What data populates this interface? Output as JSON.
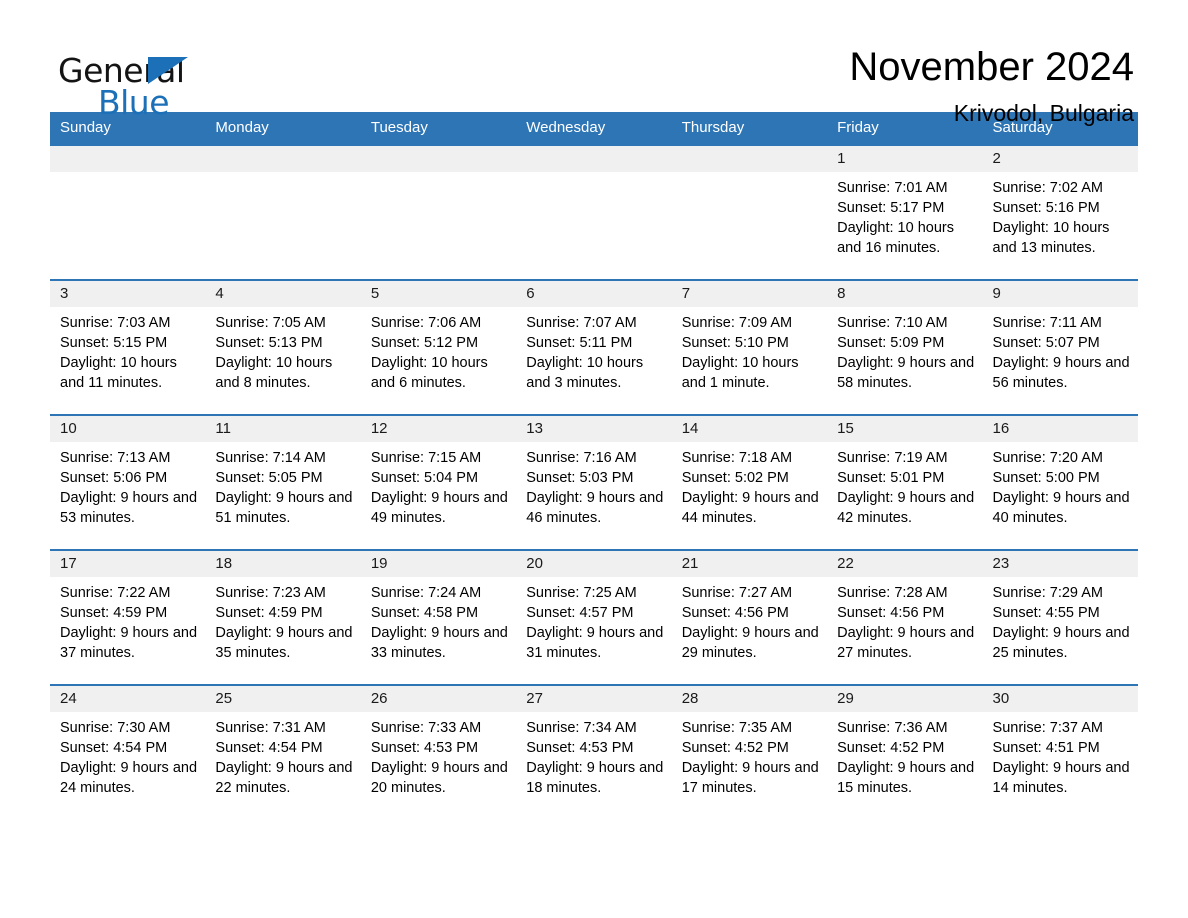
{
  "logo": {
    "word_one": "General",
    "word_two": "Blue",
    "triangle_color": "#1c70b8"
  },
  "header": {
    "month_title": "November 2024",
    "location": "Krivodol, Bulgaria"
  },
  "theme": {
    "header_blue": "#2e75b6",
    "daynum_strip": "#f0f0f0",
    "text": "#000000"
  },
  "calendar": {
    "weekday_headers": [
      "Sunday",
      "Monday",
      "Tuesday",
      "Wednesday",
      "Thursday",
      "Friday",
      "Saturday"
    ],
    "weeks": [
      [
        {
          "day": "",
          "sunrise": "",
          "sunset": "",
          "daylight": ""
        },
        {
          "day": "",
          "sunrise": "",
          "sunset": "",
          "daylight": ""
        },
        {
          "day": "",
          "sunrise": "",
          "sunset": "",
          "daylight": ""
        },
        {
          "day": "",
          "sunrise": "",
          "sunset": "",
          "daylight": ""
        },
        {
          "day": "",
          "sunrise": "",
          "sunset": "",
          "daylight": ""
        },
        {
          "day": "1",
          "sunrise": "Sunrise: 7:01 AM",
          "sunset": "Sunset: 5:17 PM",
          "daylight": "Daylight: 10 hours and 16 minutes."
        },
        {
          "day": "2",
          "sunrise": "Sunrise: 7:02 AM",
          "sunset": "Sunset: 5:16 PM",
          "daylight": "Daylight: 10 hours and 13 minutes."
        }
      ],
      [
        {
          "day": "3",
          "sunrise": "Sunrise: 7:03 AM",
          "sunset": "Sunset: 5:15 PM",
          "daylight": "Daylight: 10 hours and 11 minutes."
        },
        {
          "day": "4",
          "sunrise": "Sunrise: 7:05 AM",
          "sunset": "Sunset: 5:13 PM",
          "daylight": "Daylight: 10 hours and 8 minutes."
        },
        {
          "day": "5",
          "sunrise": "Sunrise: 7:06 AM",
          "sunset": "Sunset: 5:12 PM",
          "daylight": "Daylight: 10 hours and 6 minutes."
        },
        {
          "day": "6",
          "sunrise": "Sunrise: 7:07 AM",
          "sunset": "Sunset: 5:11 PM",
          "daylight": "Daylight: 10 hours and 3 minutes."
        },
        {
          "day": "7",
          "sunrise": "Sunrise: 7:09 AM",
          "sunset": "Sunset: 5:10 PM",
          "daylight": "Daylight: 10 hours and 1 minute."
        },
        {
          "day": "8",
          "sunrise": "Sunrise: 7:10 AM",
          "sunset": "Sunset: 5:09 PM",
          "daylight": "Daylight: 9 hours and 58 minutes."
        },
        {
          "day": "9",
          "sunrise": "Sunrise: 7:11 AM",
          "sunset": "Sunset: 5:07 PM",
          "daylight": "Daylight: 9 hours and 56 minutes."
        }
      ],
      [
        {
          "day": "10",
          "sunrise": "Sunrise: 7:13 AM",
          "sunset": "Sunset: 5:06 PM",
          "daylight": "Daylight: 9 hours and 53 minutes."
        },
        {
          "day": "11",
          "sunrise": "Sunrise: 7:14 AM",
          "sunset": "Sunset: 5:05 PM",
          "daylight": "Daylight: 9 hours and 51 minutes."
        },
        {
          "day": "12",
          "sunrise": "Sunrise: 7:15 AM",
          "sunset": "Sunset: 5:04 PM",
          "daylight": "Daylight: 9 hours and 49 minutes."
        },
        {
          "day": "13",
          "sunrise": "Sunrise: 7:16 AM",
          "sunset": "Sunset: 5:03 PM",
          "daylight": "Daylight: 9 hours and 46 minutes."
        },
        {
          "day": "14",
          "sunrise": "Sunrise: 7:18 AM",
          "sunset": "Sunset: 5:02 PM",
          "daylight": "Daylight: 9 hours and 44 minutes."
        },
        {
          "day": "15",
          "sunrise": "Sunrise: 7:19 AM",
          "sunset": "Sunset: 5:01 PM",
          "daylight": "Daylight: 9 hours and 42 minutes."
        },
        {
          "day": "16",
          "sunrise": "Sunrise: 7:20 AM",
          "sunset": "Sunset: 5:00 PM",
          "daylight": "Daylight: 9 hours and 40 minutes."
        }
      ],
      [
        {
          "day": "17",
          "sunrise": "Sunrise: 7:22 AM",
          "sunset": "Sunset: 4:59 PM",
          "daylight": "Daylight: 9 hours and 37 minutes."
        },
        {
          "day": "18",
          "sunrise": "Sunrise: 7:23 AM",
          "sunset": "Sunset: 4:59 PM",
          "daylight": "Daylight: 9 hours and 35 minutes."
        },
        {
          "day": "19",
          "sunrise": "Sunrise: 7:24 AM",
          "sunset": "Sunset: 4:58 PM",
          "daylight": "Daylight: 9 hours and 33 minutes."
        },
        {
          "day": "20",
          "sunrise": "Sunrise: 7:25 AM",
          "sunset": "Sunset: 4:57 PM",
          "daylight": "Daylight: 9 hours and 31 minutes."
        },
        {
          "day": "21",
          "sunrise": "Sunrise: 7:27 AM",
          "sunset": "Sunset: 4:56 PM",
          "daylight": "Daylight: 9 hours and 29 minutes."
        },
        {
          "day": "22",
          "sunrise": "Sunrise: 7:28 AM",
          "sunset": "Sunset: 4:56 PM",
          "daylight": "Daylight: 9 hours and 27 minutes."
        },
        {
          "day": "23",
          "sunrise": "Sunrise: 7:29 AM",
          "sunset": "Sunset: 4:55 PM",
          "daylight": "Daylight: 9 hours and 25 minutes."
        }
      ],
      [
        {
          "day": "24",
          "sunrise": "Sunrise: 7:30 AM",
          "sunset": "Sunset: 4:54 PM",
          "daylight": "Daylight: 9 hours and 24 minutes."
        },
        {
          "day": "25",
          "sunrise": "Sunrise: 7:31 AM",
          "sunset": "Sunset: 4:54 PM",
          "daylight": "Daylight: 9 hours and 22 minutes."
        },
        {
          "day": "26",
          "sunrise": "Sunrise: 7:33 AM",
          "sunset": "Sunset: 4:53 PM",
          "daylight": "Daylight: 9 hours and 20 minutes."
        },
        {
          "day": "27",
          "sunrise": "Sunrise: 7:34 AM",
          "sunset": "Sunset: 4:53 PM",
          "daylight": "Daylight: 9 hours and 18 minutes."
        },
        {
          "day": "28",
          "sunrise": "Sunrise: 7:35 AM",
          "sunset": "Sunset: 4:52 PM",
          "daylight": "Daylight: 9 hours and 17 minutes."
        },
        {
          "day": "29",
          "sunrise": "Sunrise: 7:36 AM",
          "sunset": "Sunset: 4:52 PM",
          "daylight": "Daylight: 9 hours and 15 minutes."
        },
        {
          "day": "30",
          "sunrise": "Sunrise: 7:37 AM",
          "sunset": "Sunset: 4:51 PM",
          "daylight": "Daylight: 9 hours and 14 minutes."
        }
      ]
    ]
  }
}
